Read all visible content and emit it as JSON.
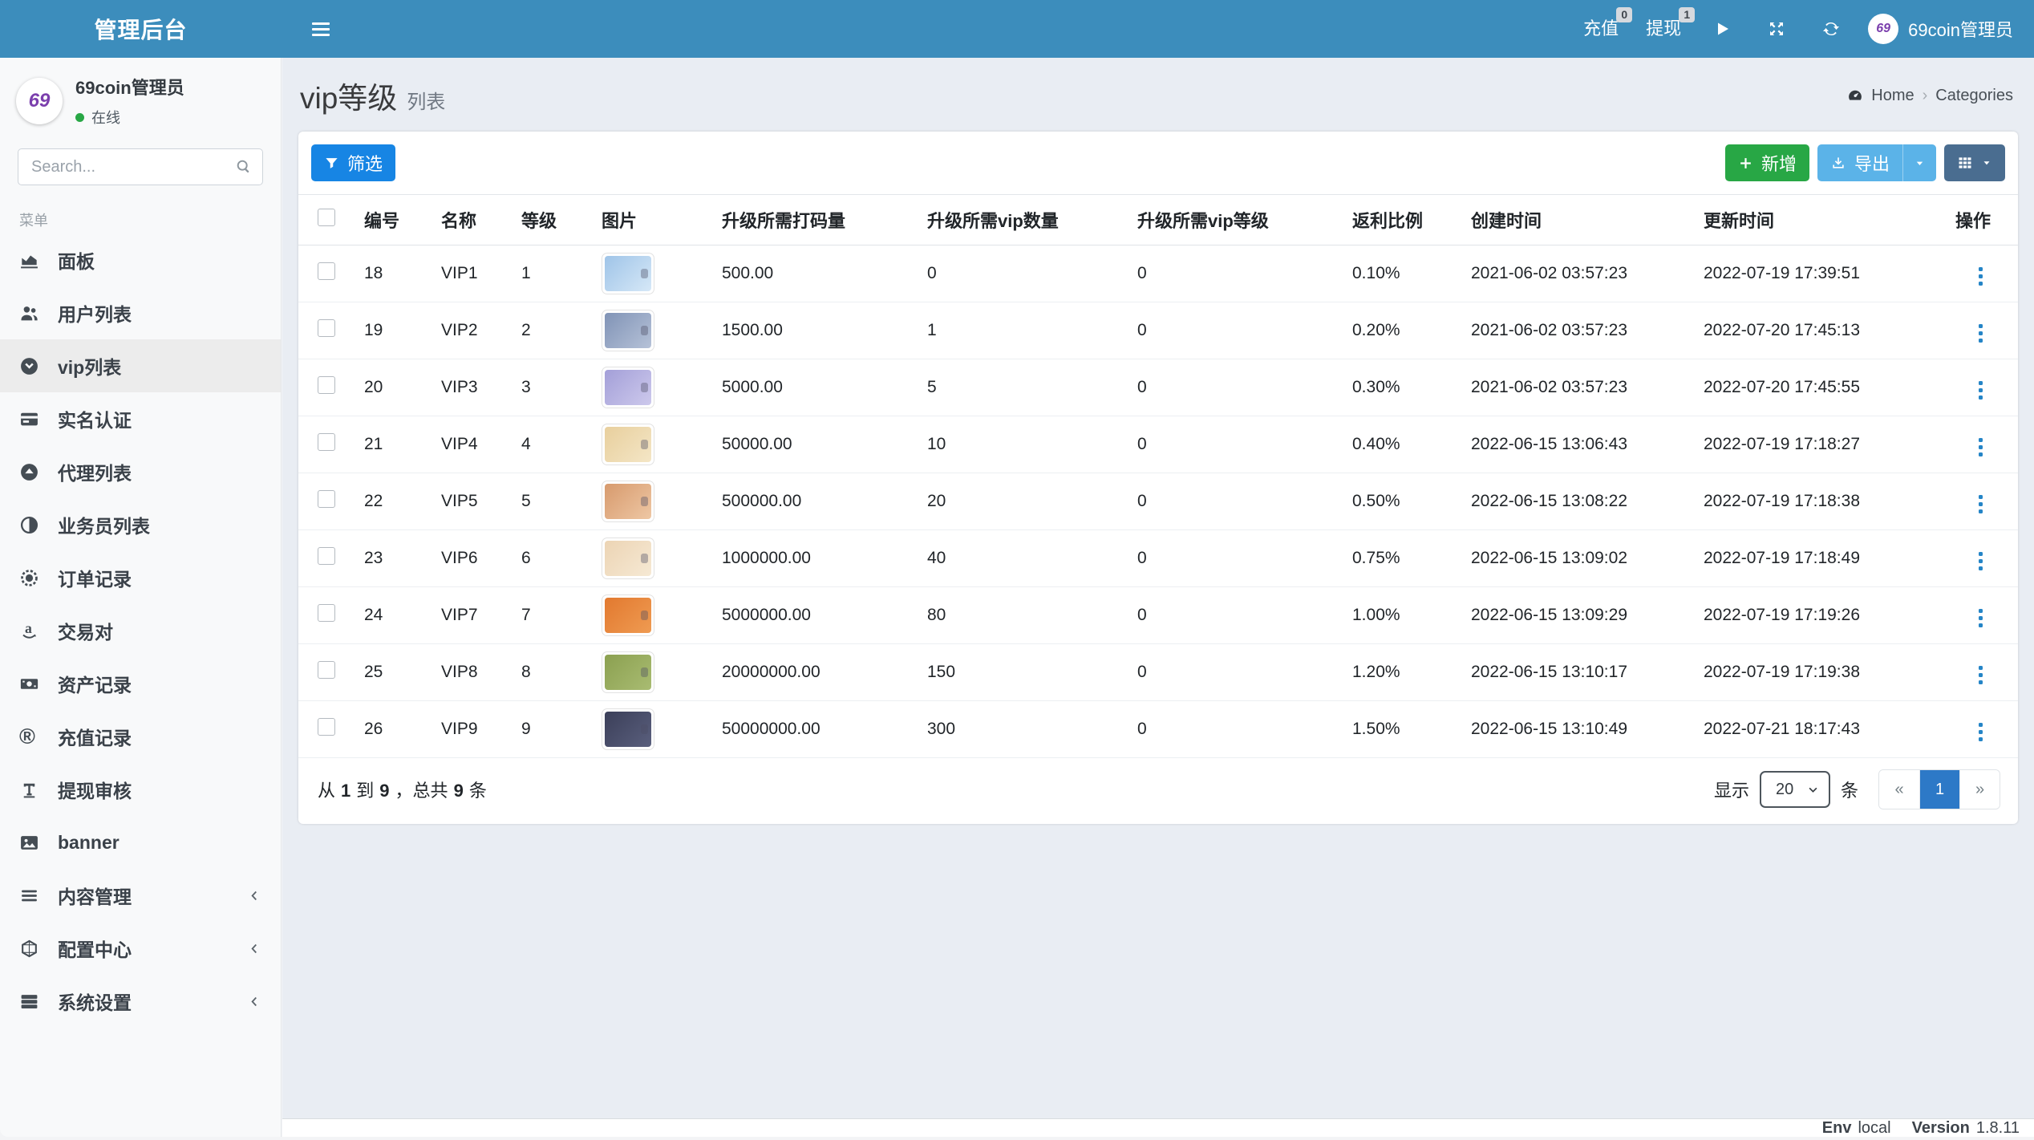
{
  "navbar": {
    "brand": "管理后台",
    "links": [
      {
        "label": "充值",
        "badge": "0"
      },
      {
        "label": "提现",
        "badge": "1"
      }
    ],
    "user_name": "69coin管理员",
    "logo_text": "69"
  },
  "sidebar": {
    "user": {
      "name": "69coin管理员",
      "status": "在线"
    },
    "search_placeholder": "Search...",
    "section_label": "菜单",
    "items": [
      {
        "key": "dashboard",
        "label": "面板",
        "icon": "chart-area-icon"
      },
      {
        "key": "users",
        "label": "用户列表",
        "icon": "users-icon"
      },
      {
        "key": "vip",
        "label": "vip列表",
        "icon": "circle-chevron-down-icon",
        "active": true
      },
      {
        "key": "kyc",
        "label": "实名认证",
        "icon": "id-card-icon"
      },
      {
        "key": "agents",
        "label": "代理列表",
        "icon": "circle-caret-up-icon"
      },
      {
        "key": "salesmen",
        "label": "业务员列表",
        "icon": "adjust-icon"
      },
      {
        "key": "orders",
        "label": "订单记录",
        "icon": "dashed-circle-icon"
      },
      {
        "key": "pairs",
        "label": "交易对",
        "icon": "amazon-icon"
      },
      {
        "key": "assets",
        "label": "资产记录",
        "icon": "money-bill-icon"
      },
      {
        "key": "recharge",
        "label": "充值记录",
        "icon": "registered-icon"
      },
      {
        "key": "withdraw-audit",
        "label": "提现审核",
        "icon": "text-height-icon"
      },
      {
        "key": "banner",
        "label": "banner",
        "icon": "image-icon"
      },
      {
        "key": "content",
        "label": "内容管理",
        "icon": "bars-icon",
        "expandable": true
      },
      {
        "key": "config",
        "label": "配置中心",
        "icon": "hexagon-icon",
        "expandable": true
      },
      {
        "key": "system",
        "label": "系统设置",
        "icon": "server-icon",
        "expandable": true
      }
    ]
  },
  "page": {
    "title": "vip等级",
    "subtitle": "列表",
    "breadcrumb": {
      "home": "Home",
      "current": "Categories"
    }
  },
  "toolbar": {
    "filter_label": "筛选",
    "add_label": "新增",
    "export_label": "导出"
  },
  "table": {
    "columns": [
      {
        "key": "id",
        "label": "编号"
      },
      {
        "key": "name",
        "label": "名称"
      },
      {
        "key": "level",
        "label": "等级"
      },
      {
        "key": "image",
        "label": "图片"
      },
      {
        "key": "bet",
        "label": "升级所需打码量"
      },
      {
        "key": "vip-count",
        "label": "升级所需vip数量"
      },
      {
        "key": "vip-level",
        "label": "升级所需vip等级"
      },
      {
        "key": "rebate",
        "label": "返利比例"
      },
      {
        "key": "created",
        "label": "创建时间"
      },
      {
        "key": "updated",
        "label": "更新时间"
      },
      {
        "key": "actions",
        "label": "操作"
      }
    ],
    "rows": [
      {
        "id": "18",
        "name": "VIP1",
        "level": "1",
        "image_colors": [
          "#9fc4e8",
          "#d6e8f7"
        ],
        "bet_amount": "500.00",
        "vip_count": "0",
        "vip_level": "0",
        "rebate": "0.10%",
        "created_at": "2021-06-02 03:57:23",
        "updated_at": "2022-07-19 17:39:51"
      },
      {
        "id": "19",
        "name": "VIP2",
        "level": "2",
        "image_colors": [
          "#8093b6",
          "#b6c2d8"
        ],
        "bet_amount": "1500.00",
        "vip_count": "1",
        "vip_level": "0",
        "rebate": "0.20%",
        "created_at": "2021-06-02 03:57:23",
        "updated_at": "2022-07-20 17:45:13"
      },
      {
        "id": "20",
        "name": "VIP3",
        "level": "3",
        "image_colors": [
          "#a39fd8",
          "#cdc9ec"
        ],
        "bet_amount": "5000.00",
        "vip_count": "5",
        "vip_level": "0",
        "rebate": "0.30%",
        "created_at": "2021-06-02 03:57:23",
        "updated_at": "2022-07-20 17:45:55"
      },
      {
        "id": "21",
        "name": "VIP4",
        "level": "4",
        "image_colors": [
          "#e8cf9d",
          "#f4e6c6"
        ],
        "bet_amount": "50000.00",
        "vip_count": "10",
        "vip_level": "0",
        "rebate": "0.40%",
        "created_at": "2022-06-15 13:06:43",
        "updated_at": "2022-07-19 17:18:27"
      },
      {
        "id": "22",
        "name": "VIP5",
        "level": "5",
        "image_colors": [
          "#d79a6d",
          "#eec7a4"
        ],
        "bet_amount": "500000.00",
        "vip_count": "20",
        "vip_level": "0",
        "rebate": "0.50%",
        "created_at": "2022-06-15 13:08:22",
        "updated_at": "2022-07-19 17:18:38"
      },
      {
        "id": "23",
        "name": "VIP6",
        "level": "6",
        "image_colors": [
          "#ecd4b4",
          "#f6e9d4"
        ],
        "bet_amount": "1000000.00",
        "vip_count": "40",
        "vip_level": "0",
        "rebate": "0.75%",
        "created_at": "2022-06-15 13:09:02",
        "updated_at": "2022-07-19 17:18:49"
      },
      {
        "id": "24",
        "name": "VIP7",
        "level": "7",
        "image_colors": [
          "#e2792f",
          "#ef9b52"
        ],
        "bet_amount": "5000000.00",
        "vip_count": "80",
        "vip_level": "0",
        "rebate": "1.00%",
        "created_at": "2022-06-15 13:09:29",
        "updated_at": "2022-07-19 17:19:26"
      },
      {
        "id": "25",
        "name": "VIP8",
        "level": "8",
        "image_colors": [
          "#8ba050",
          "#a9bc72"
        ],
        "bet_amount": "20000000.00",
        "vip_count": "150",
        "vip_level": "0",
        "rebate": "1.20%",
        "created_at": "2022-06-15 13:10:17",
        "updated_at": "2022-07-19 17:19:38"
      },
      {
        "id": "26",
        "name": "VIP9",
        "level": "9",
        "image_colors": [
          "#3b3f59",
          "#5a5f7d"
        ],
        "bet_amount": "50000000.00",
        "vip_count": "300",
        "vip_level": "0",
        "rebate": "1.50%",
        "created_at": "2022-06-15 13:10:49",
        "updated_at": "2022-07-21 18:17:43"
      }
    ]
  },
  "pagination": {
    "info": {
      "from_label": "从",
      "start": "1",
      "to_label": "到",
      "end": "9",
      "comma": "，",
      "total_label": "总共",
      "total": "9",
      "unit": "条"
    },
    "show_label": "显示",
    "page_size": "20",
    "unit_label": "条",
    "prev": "«",
    "page": "1",
    "next": "»"
  },
  "footer": {
    "env_label": "Env",
    "env_value": "local",
    "version_label": "Version",
    "version_value": "1.8.11"
  },
  "colors": {
    "navbar": "#3c8dbc",
    "sidebar_bg": "#f8f9fa",
    "sidebar_active": "#ececec",
    "content_bg": "#e9edf3",
    "primary": "#1785e4",
    "success": "#28a745",
    "info": "#5bb3e8",
    "steel": "#4a6d90",
    "pager_active": "#2d79c7",
    "action_blue": "#2585c7",
    "logo_purple": "#7b3fad",
    "status_green": "#28a745",
    "badge_bg": "#d6d9de"
  }
}
